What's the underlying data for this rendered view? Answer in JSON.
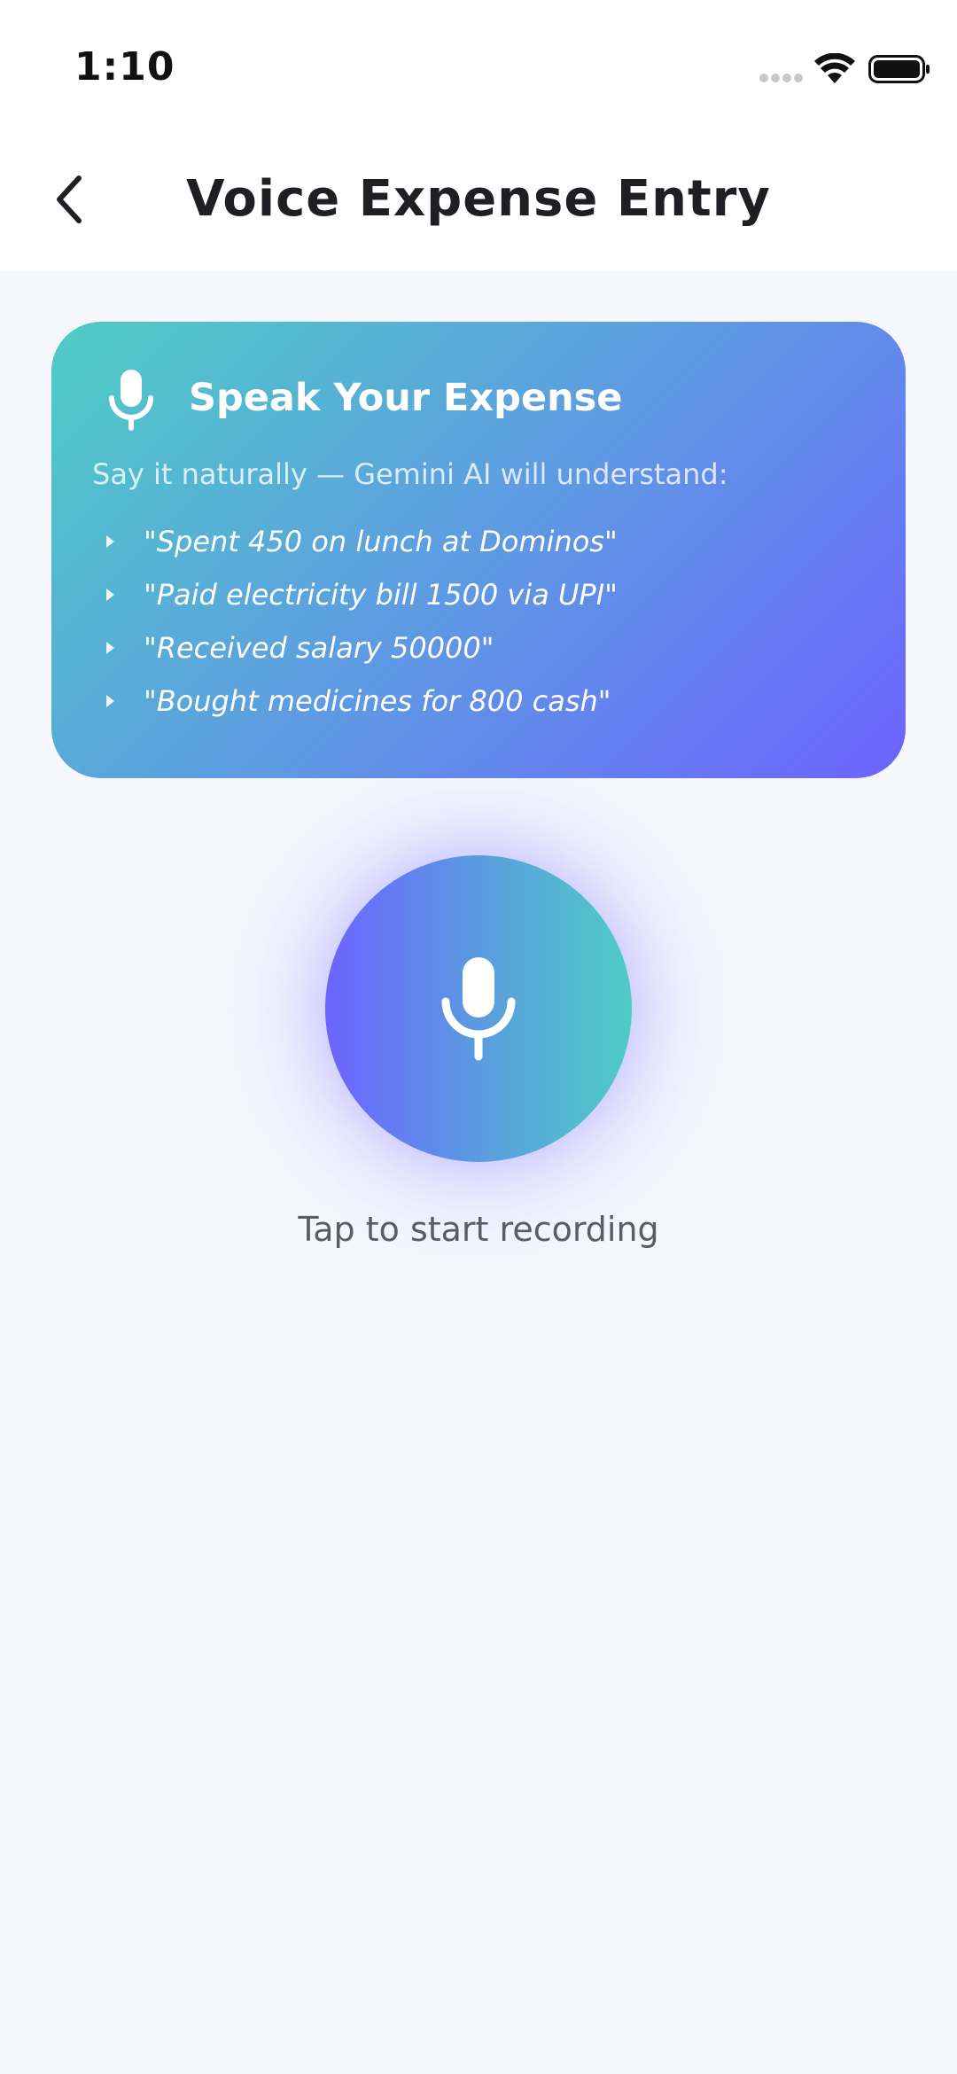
{
  "status_bar": {
    "time": "1:10"
  },
  "header": {
    "title": "Voice Expense Entry",
    "back_icon": "chevron-left-icon"
  },
  "info_card": {
    "icon": "microphone-icon",
    "title": "Speak Your Expense",
    "subtitle": "Say it naturally — Gemini AI will understand:",
    "examples": [
      "\"Spent 450 on lunch at Dominos\"",
      "\"Paid electricity bill 1500 via UPI\"",
      "\"Received salary 50000\"",
      "\"Bought medicines for 800 cash\""
    ],
    "gradient_colors": [
      "#4ECDC4",
      "#6C63FF"
    ]
  },
  "record": {
    "icon": "microphone-icon",
    "hint": "Tap to start recording",
    "gradient_colors": [
      "#6C63FF",
      "#4ECDC4"
    ]
  },
  "colors": {
    "background": "#F6F7FD",
    "title_text": "#1F1F23",
    "hint_text": "#5C5C66"
  }
}
